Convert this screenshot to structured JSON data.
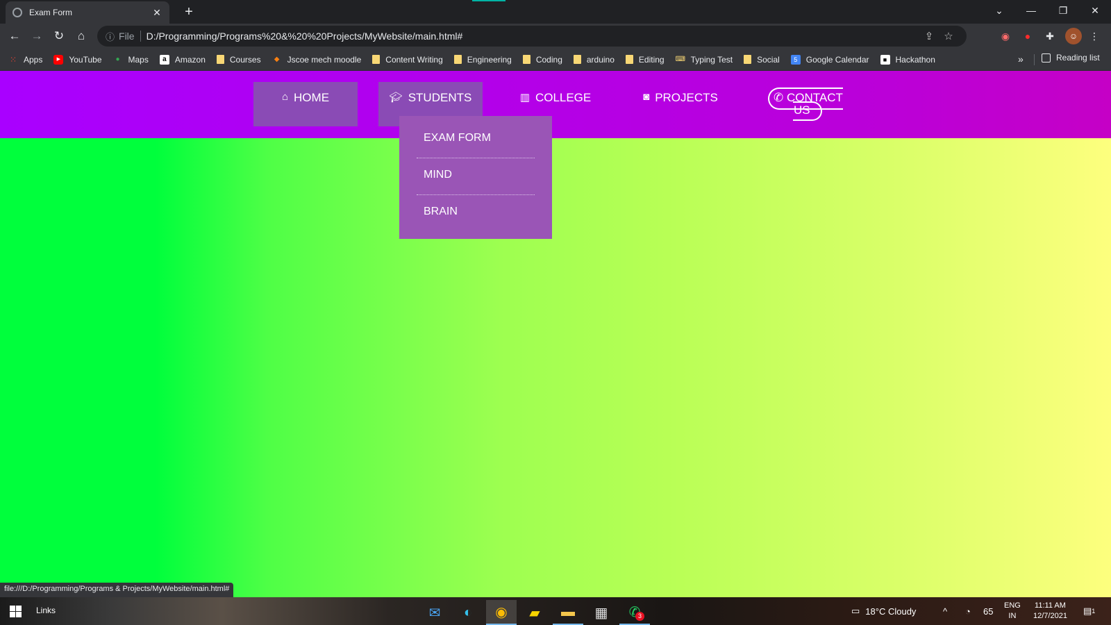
{
  "browser": {
    "tab_title": "Exam Form",
    "new_tab": "+",
    "url_scheme": "File",
    "url": "D:/Programming/Programs%20&%20%20Projects/MyWebsite/main.html#",
    "status_url": "file:///D:/Programming/Programs &  Projects/MyWebsite/main.html#"
  },
  "bookmarks": [
    {
      "label": "Apps",
      "icon": "apps-grid-icon"
    },
    {
      "label": "YouTube",
      "icon": "youtube-icon"
    },
    {
      "label": "Maps",
      "icon": "maps-icon"
    },
    {
      "label": "Amazon",
      "icon": "amazon-icon"
    },
    {
      "label": "Courses",
      "icon": "folder-icon"
    },
    {
      "label": "Jscoe mech moodle",
      "icon": "moodle-icon"
    },
    {
      "label": "Content Writing",
      "icon": "folder-icon"
    },
    {
      "label": "Engineering",
      "icon": "folder-icon"
    },
    {
      "label": "Coding",
      "icon": "folder-icon"
    },
    {
      "label": "arduino",
      "icon": "folder-icon"
    },
    {
      "label": "Editing",
      "icon": "folder-icon"
    },
    {
      "label": "Typing Test",
      "icon": "typing-test-icon"
    },
    {
      "label": "Social",
      "icon": "folder-icon"
    },
    {
      "label": "Google Calendar",
      "icon": "calendar-icon"
    },
    {
      "label": "Hackathon",
      "icon": "hackathon-icon"
    }
  ],
  "bookmarks_more": "»",
  "reading_list": "Reading list",
  "site_nav": {
    "home": "HOME",
    "students": "STUDENTS",
    "college": "COLLEGE",
    "projects": "PROJECTS",
    "contact_line1": "CONTACT",
    "contact_line2": "US"
  },
  "dropdown": [
    "EXAM FORM",
    "MIND",
    "BRAIN"
  ],
  "taskbar": {
    "links": "Links",
    "whatsapp_badge": "3",
    "weather": "18°C  Cloudy",
    "battery": "65",
    "lang_top": "ENG",
    "lang_bottom": "IN",
    "time": "11:11 AM",
    "date": "12/7/2021",
    "notif_count": "1"
  },
  "colors": {
    "nav_gradient_start": "#a900ff",
    "nav_gradient_end": "#c500c6",
    "active_item": "#8a4bb5",
    "dropdown_bg": "#9a55b6",
    "page_gradient_start": "#00ff3c",
    "page_gradient_end": "#fdff7e"
  }
}
